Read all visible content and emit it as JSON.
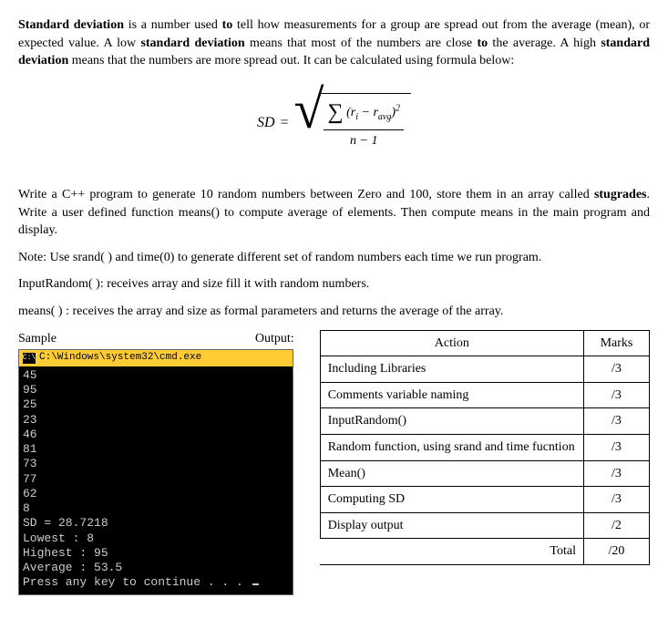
{
  "intro": {
    "strong1": "Standard deviation",
    "t1": " is a number used ",
    "strong2": "to",
    "t2": " tell how measurements for a group are spread out from the average (mean), or expected value. A low ",
    "strong3": "standard deviation",
    "t3": " means that most of the numbers are close ",
    "strong4": "to",
    "t4": " the average. A high ",
    "strong5": "standard deviation",
    "t5": " means that the numbers are more spread out. It can be calculated using formula below:"
  },
  "formula": {
    "sd": "SD",
    "eq": "=",
    "sigma": "∑",
    "r": "r",
    "i": "i",
    "minus": "−",
    "avg": "avg",
    "sq": "2",
    "n": "n",
    "one": "1"
  },
  "task": {
    "p1a": "Write a C++ program to generate 10 random numbers between Zero and 100, store them in an array called ",
    "p1b": "stugrades",
    "p1c": ". Write a user defined function means() to compute average of elements. Then compute means in the main program and display.",
    "p2": "Note: Use srand( ) and time(0) to generate different set of random numbers  each time we run program.",
    "p3": "InputRandom( ): receives array  and size  fill it with random numbers.",
    "p4": "means( ) : receives the array and size as formal parameters and returns the average of the array."
  },
  "sample": {
    "label": "Sample",
    "output_label": "Output:",
    "title_icon": "C:\\",
    "title": "C:\\Windows\\system32\\cmd.exe",
    "lines": [
      "45",
      "95",
      "25",
      "23",
      "46",
      "81",
      "73",
      "77",
      "62",
      "8",
      "SD = 28.7218",
      "Lowest : 8",
      "Highest : 95",
      "Average : 53.5",
      "Press any key to continue . . . "
    ]
  },
  "rubric": {
    "head_action": "Action",
    "head_marks": "Marks",
    "rows": [
      {
        "action": "Including Libraries",
        "marks": "/3"
      },
      {
        "action": "Comments variable naming",
        "marks": "/3"
      },
      {
        "action": "InputRandom()",
        "marks": "/3"
      },
      {
        "action": "Random function, using srand  and time fucntion",
        "marks": "/3"
      },
      {
        "action": "Mean()",
        "marks": "/3"
      },
      {
        "action": "Computing SD",
        "marks": "/3"
      },
      {
        "action": "Display output",
        "marks": "/2"
      }
    ],
    "total_label": "Total",
    "total_value": "/20"
  }
}
